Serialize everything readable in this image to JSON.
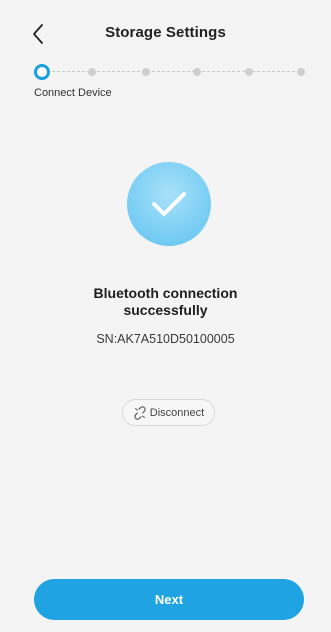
{
  "header": {
    "title": "Storage Settings",
    "back_icon": "chevron-left-icon"
  },
  "stepper": {
    "total_steps": 6,
    "current_step": 1,
    "current_label": "Connect Device",
    "active_color": "#1a9fe0"
  },
  "status": {
    "icon": "checkmark-icon",
    "title_line1": "Bluetooth connection",
    "title_line2": "successfully",
    "serial": "SN:AK7A510D50100005"
  },
  "disconnect": {
    "icon": "unlink-icon",
    "label": "Disconnect"
  },
  "footer": {
    "next_label": "Next",
    "accent_color": "#1fa3e2"
  }
}
